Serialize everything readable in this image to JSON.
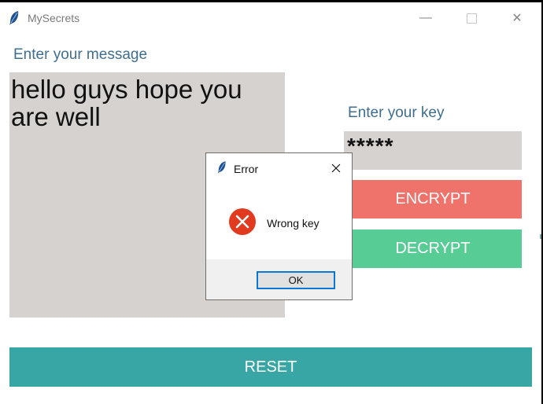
{
  "window": {
    "title": "MySecrets",
    "icon": "feather-icon",
    "controls": [
      "minimize-icon",
      "maximize-icon",
      "close-icon"
    ],
    "minimize_glyph": "—",
    "close_glyph": "✕"
  },
  "message": {
    "label": "Enter your message",
    "value": "hello guys hope you are well"
  },
  "key": {
    "label": "Enter your key",
    "value": "*****"
  },
  "buttons": {
    "encrypt": "ENCRYPT",
    "decrypt": "DECRYPT",
    "reset": "RESET"
  },
  "dialog": {
    "title": "Error",
    "icon": "error-icon",
    "message": "Wrong key",
    "ok_label": "OK"
  },
  "colors": {
    "label_text": "#3f6e8f",
    "field_bg": "#d6d2cf",
    "encrypt": "#f0736b",
    "decrypt": "#58cc95",
    "reset": "#38a6a5",
    "error_icon": "#e23a1e",
    "ok_border": "#0a78d4"
  }
}
